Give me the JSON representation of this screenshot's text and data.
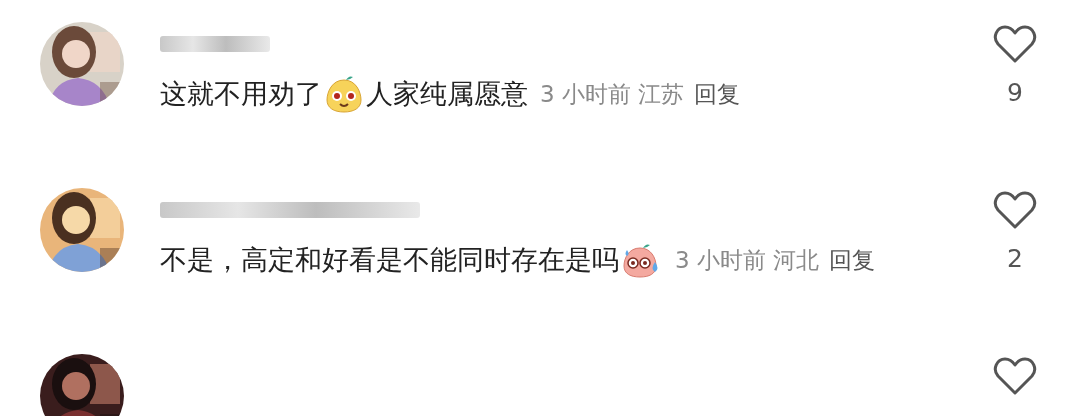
{
  "comments": [
    {
      "body": [
        {
          "kind": "text",
          "text": "这就不用劝了"
        },
        {
          "kind": "emoji"
        },
        {
          "kind": "text",
          "text": "人家纯属愿意"
        }
      ],
      "meta": {
        "time": "3 小时前",
        "location": "江苏",
        "reply": "回复"
      },
      "likes": "9",
      "liked": false
    },
    {
      "body": [
        {
          "kind": "text",
          "text": "不是，高定和好看是不能同时存在是吗"
        },
        {
          "kind": "emoji"
        }
      ],
      "meta": {
        "time": "3 小时前",
        "location": "河北",
        "reply": "回复"
      },
      "likes": "2",
      "liked": false
    },
    {
      "liked": false
    }
  ]
}
